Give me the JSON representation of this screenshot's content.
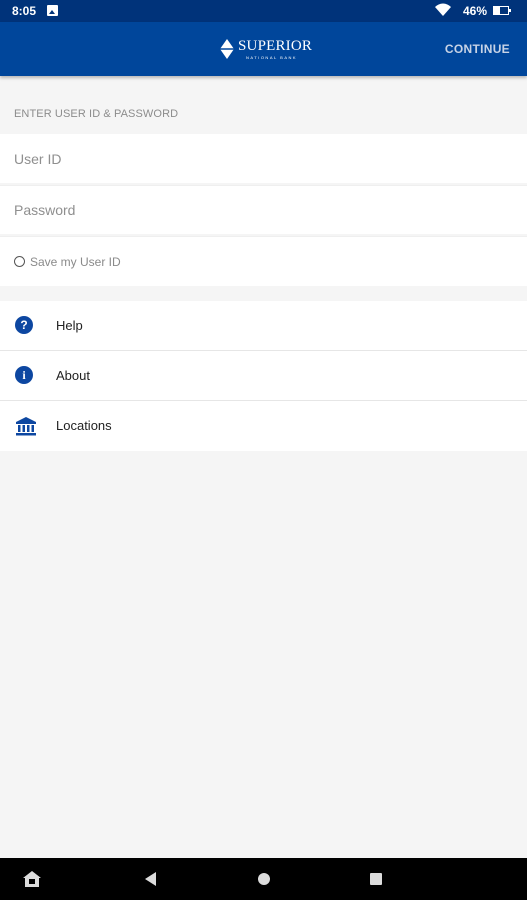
{
  "status_bar": {
    "time": "8:05",
    "battery_text": "46%",
    "battery_level": 0.46,
    "icons": [
      "image-notification-icon",
      "wifi-icon",
      "battery-icon"
    ]
  },
  "app_bar": {
    "logo_text": "SUPERIOR",
    "logo_subtext": "NATIONAL BANK",
    "continue_label": "CONTINUE"
  },
  "login": {
    "section_label": "ENTER USER ID & PASSWORD",
    "user_id_placeholder": "User ID",
    "password_placeholder": "Password",
    "save_user_id_label": "Save my User ID",
    "save_user_id_checked": false
  },
  "menu": {
    "items": [
      {
        "label": "Help",
        "icon": "help-icon"
      },
      {
        "label": "About",
        "icon": "info-icon"
      },
      {
        "label": "Locations",
        "icon": "bank-icon"
      }
    ]
  },
  "colors": {
    "status_bar": "#00337a",
    "app_bar": "#00469b",
    "accent": "#0d47a1",
    "background": "#f5f5f5"
  }
}
